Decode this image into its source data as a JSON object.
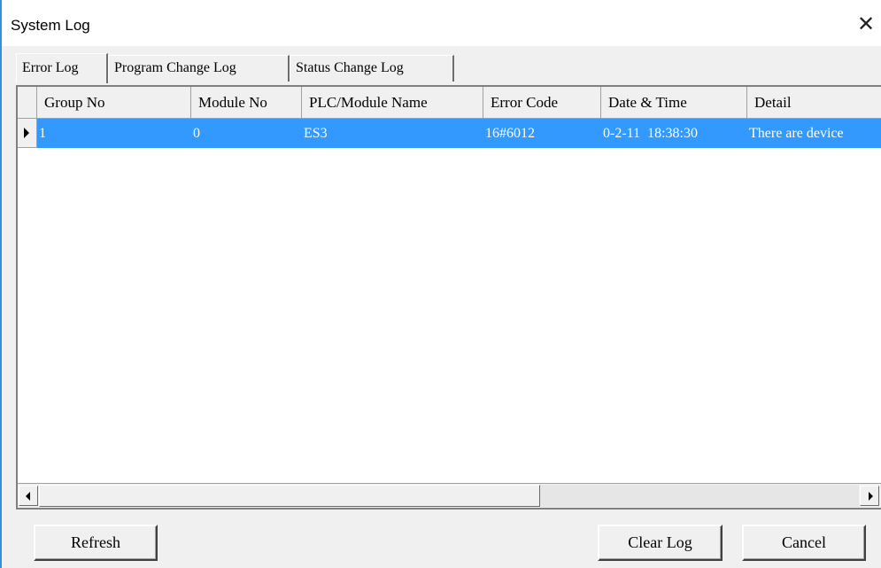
{
  "window": {
    "title": "System Log",
    "close_glyph": "✕"
  },
  "tabs": [
    {
      "label": "Error Log",
      "active": true
    },
    {
      "label": "Program Change Log",
      "active": false
    },
    {
      "label": "Status Change Log",
      "active": false
    }
  ],
  "table": {
    "columns": [
      "Group No",
      "Module No",
      "PLC/Module Name",
      "Error Code",
      "Date & Time",
      "Detail"
    ],
    "rows": [
      [
        "1",
        "0",
        "ES3",
        "16#6012",
        "0-2-11  18:38:30",
        "There are device"
      ]
    ],
    "selected_row": 0
  },
  "buttons": {
    "refresh": "Refresh",
    "clear_log": "Clear Log",
    "cancel": "Cancel"
  },
  "colors": {
    "selection": "#3399ff",
    "accent_edge": "#3a8ed8"
  }
}
